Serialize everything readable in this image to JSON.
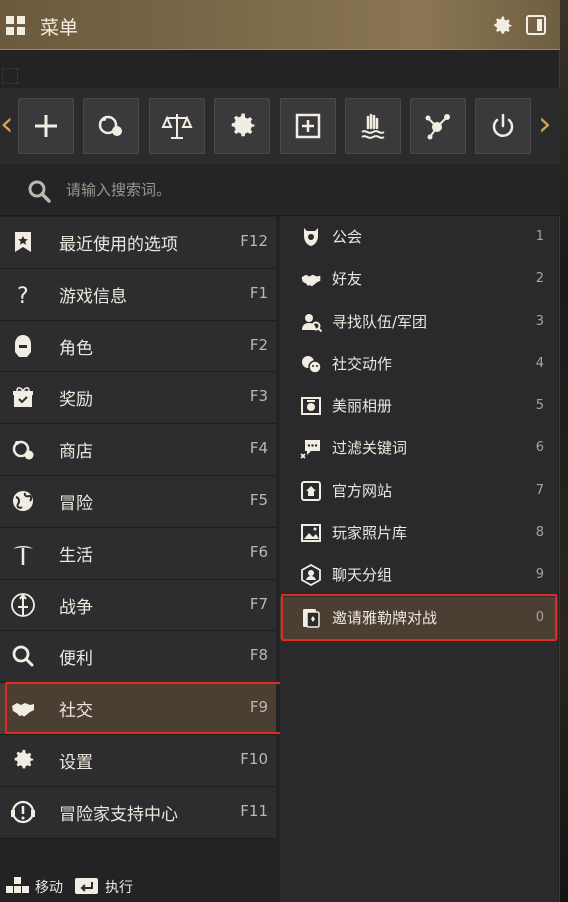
{
  "header": {
    "title": "菜单",
    "accent_color": "#7a6848"
  },
  "toolbar": {
    "buttons": [
      {
        "icon": "plus-icon"
      },
      {
        "icon": "shop-icon"
      },
      {
        "icon": "scales-icon"
      },
      {
        "icon": "gear-icon"
      },
      {
        "icon": "add-frame-icon"
      },
      {
        "icon": "hand-wave-icon"
      },
      {
        "icon": "network-icon"
      },
      {
        "icon": "power-icon"
      }
    ]
  },
  "search": {
    "placeholder": "请输入搜索词。"
  },
  "left_menu": {
    "items": [
      {
        "label": "最近使用的选项",
        "key": "F12",
        "icon": "bookmark-star-icon"
      },
      {
        "label": "游戏信息",
        "key": "F1",
        "icon": "question-icon"
      },
      {
        "label": "角色",
        "key": "F2",
        "icon": "helmet-icon"
      },
      {
        "label": "奖励",
        "key": "F3",
        "icon": "gift-icon"
      },
      {
        "label": "商店",
        "key": "F4",
        "icon": "shop-icon"
      },
      {
        "label": "冒险",
        "key": "F5",
        "icon": "globe-icon"
      },
      {
        "label": "生活",
        "key": "F6",
        "icon": "pickaxe-icon"
      },
      {
        "label": "战争",
        "key": "F7",
        "icon": "sword-emblem-icon"
      },
      {
        "label": "便利",
        "key": "F8",
        "icon": "magnifier-icon"
      },
      {
        "label": "社交",
        "key": "F9",
        "icon": "handshake-icon",
        "active": true
      },
      {
        "label": "设置",
        "key": "F10",
        "icon": "gear-icon"
      },
      {
        "label": "冒险家支持中心",
        "key": "F11",
        "icon": "support-headset-icon"
      }
    ]
  },
  "right_menu": {
    "items": [
      {
        "label": "公会",
        "key": "1",
        "icon": "guild-icon"
      },
      {
        "label": "好友",
        "key": "2",
        "icon": "handshake-icon"
      },
      {
        "label": "寻找队伍/军团",
        "key": "3",
        "icon": "party-icon"
      },
      {
        "label": "社交动作",
        "key": "4",
        "icon": "emote-icon"
      },
      {
        "label": "美丽相册",
        "key": "5",
        "icon": "camera-icon"
      },
      {
        "label": "过滤关键词",
        "key": "6",
        "icon": "chat-filter-icon"
      },
      {
        "label": "官方网站",
        "key": "7",
        "icon": "home-page-icon"
      },
      {
        "label": "玩家照片库",
        "key": "8",
        "icon": "photo-gallery-icon"
      },
      {
        "label": "聊天分组",
        "key": "9",
        "icon": "chat-group-icon"
      },
      {
        "label": "邀请雅勒牌对战",
        "key": "0",
        "icon": "card-battle-icon",
        "active": true
      }
    ]
  },
  "footer": {
    "move_label": "移动",
    "execute_label": "执行"
  },
  "colors": {
    "highlight": "#e02a24",
    "arrow": "#d7a24e",
    "active_bg": "#4a3f32"
  }
}
